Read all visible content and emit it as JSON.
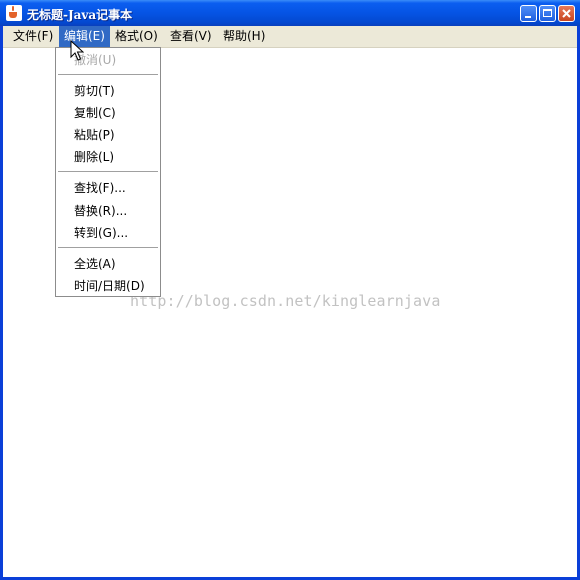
{
  "window": {
    "title": "无标题-Java记事本",
    "app_icon": "java-cup-icon",
    "controls": [
      "minimize-icon",
      "maximize-icon",
      "close-icon"
    ]
  },
  "menubar": {
    "items": [
      {
        "label": "文件(F)",
        "active": false
      },
      {
        "label": "编辑(E)",
        "active": true
      },
      {
        "label": "格式(O)",
        "active": false
      },
      {
        "label": "查看(V)",
        "active": false
      },
      {
        "label": "帮助(H)",
        "active": false
      }
    ]
  },
  "edit_menu": {
    "groups": [
      [
        {
          "label": "撤消(U)",
          "enabled": false
        }
      ],
      [
        {
          "label": "剪切(T)",
          "enabled": true
        },
        {
          "label": "复制(C)",
          "enabled": true
        },
        {
          "label": "粘贴(P)",
          "enabled": true
        },
        {
          "label": "删除(L)",
          "enabled": true
        }
      ],
      [
        {
          "label": "查找(F)...",
          "enabled": true
        },
        {
          "label": "替换(R)...",
          "enabled": true
        },
        {
          "label": "转到(G)...",
          "enabled": true
        }
      ],
      [
        {
          "label": "全选(A)",
          "enabled": true
        },
        {
          "label": "时间/日期(D)",
          "enabled": true
        }
      ]
    ]
  },
  "editor": {
    "content": ""
  },
  "watermark": "http://blog.csdn.net/kinglearnjava",
  "colors": {
    "title_bar": "#0554e4",
    "menu_highlight": "#316ac5",
    "menubar_bg": "#ece9d8",
    "disabled_text": "#a8a8a8"
  }
}
